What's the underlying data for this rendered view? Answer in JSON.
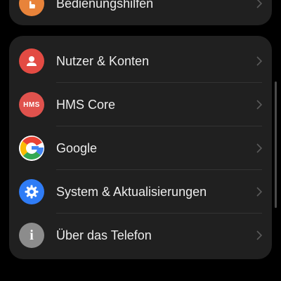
{
  "colors": {
    "background": "#000000",
    "card": "#202020",
    "text": "#ececec",
    "divider": "#333333",
    "chevron": "#5a5a5a",
    "accessibility_icon": "#e8833a",
    "users_icon": "#e34b43",
    "hms_icon": "#e0524d",
    "system_icon": "#2f7cf6",
    "about_icon": "#8c8c8c"
  },
  "top_card": {
    "item": {
      "label": "Bedienungshilfen",
      "icon": "hand-icon"
    }
  },
  "settings_list": {
    "items": [
      {
        "label": "Nutzer & Konten",
        "icon": "person-icon"
      },
      {
        "label": "HMS Core",
        "icon": "hms-icon",
        "icon_text": "HMS"
      },
      {
        "label": "Google",
        "icon": "google-icon",
        "icon_text": "G"
      },
      {
        "label": "System & Aktualisierungen",
        "icon": "gear-icon"
      },
      {
        "label": "Über das Telefon",
        "icon": "info-icon",
        "icon_text": "i"
      }
    ]
  }
}
